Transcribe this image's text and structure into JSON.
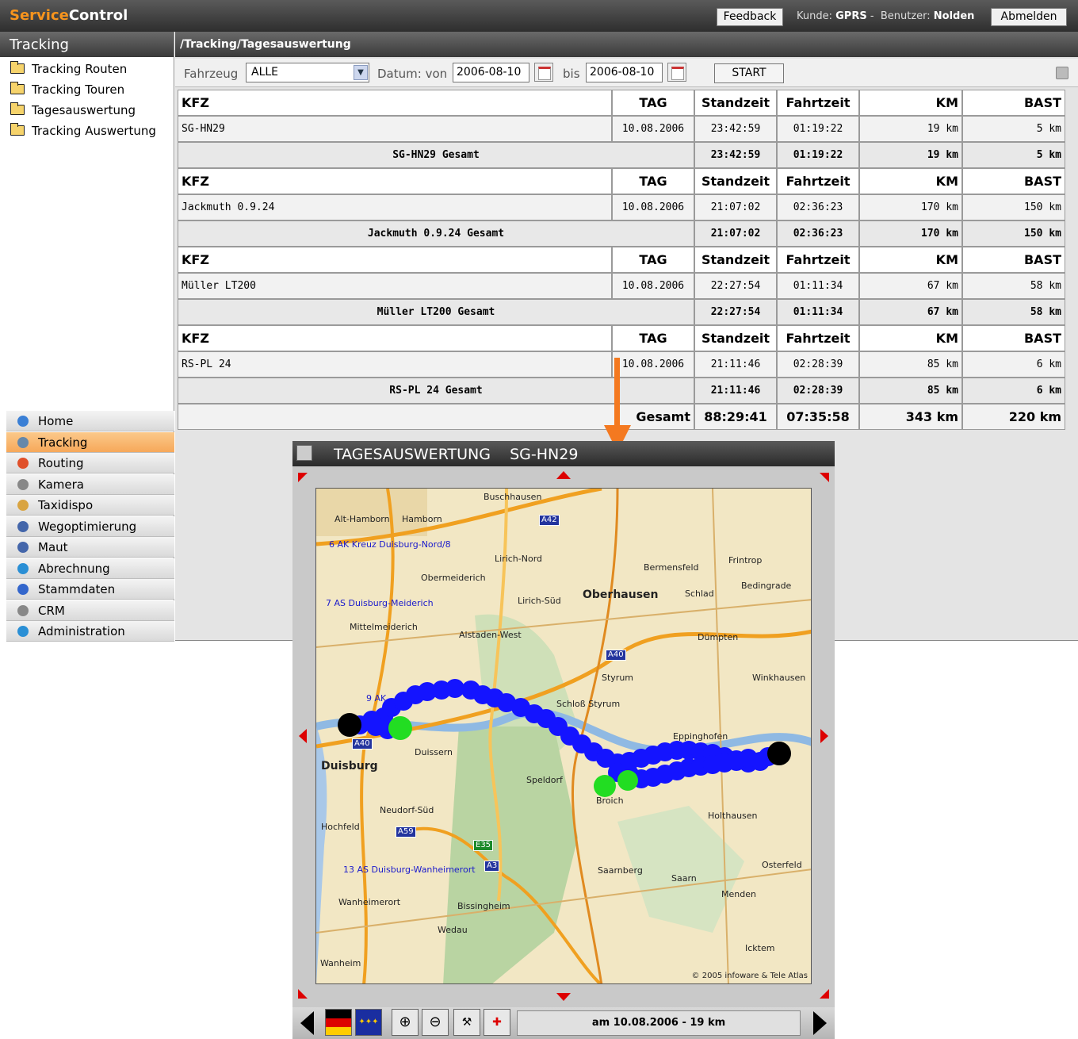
{
  "header": {
    "logo_part1": "Service",
    "logo_part2": "Control",
    "feedback": "Feedback",
    "kunde_label": "Kunde:",
    "kunde": "GPRS",
    "separator": "-",
    "benutzer_label": "Benutzer:",
    "benutzer": "Nolden",
    "abmelden": "Abmelden"
  },
  "sidebar": {
    "title": "Tracking",
    "tree": [
      "Tracking Routen",
      "Tracking Touren",
      "Tagesauswertung",
      "Tracking Auswertung"
    ],
    "nav": [
      {
        "label": "Home",
        "icon": "home-icon",
        "color": "#3a7fd5"
      },
      {
        "label": "Tracking",
        "icon": "tracking-icon",
        "color": "#6688aa",
        "active": true
      },
      {
        "label": "Routing",
        "icon": "routing-icon",
        "color": "#e0502a"
      },
      {
        "label": "Kamera",
        "icon": "camera-icon",
        "color": "#888888"
      },
      {
        "label": "Taxidispo",
        "icon": "taxi-icon",
        "color": "#d9a441"
      },
      {
        "label": "Wegoptimierung",
        "icon": "route-opt-icon",
        "color": "#4466aa"
      },
      {
        "label": "Maut",
        "icon": "toll-icon",
        "color": "#4466aa"
      },
      {
        "label": "Abrechnung",
        "icon": "billing-icon",
        "color": "#2a8fd5"
      },
      {
        "label": "Stammdaten",
        "icon": "master-data-icon",
        "color": "#3366cc"
      },
      {
        "label": "CRM",
        "icon": "crm-icon",
        "color": "#888888"
      },
      {
        "label": "Administration",
        "icon": "admin-icon",
        "color": "#2a8fd5"
      }
    ]
  },
  "main": {
    "breadcrumb": "/Tracking/Tagesauswertung",
    "filter": {
      "fahrzeug_label": "Fahrzeug",
      "fahrzeug_value": "ALLE",
      "datum_label": "Datum: von",
      "from": "2006-08-10",
      "bis_label": "bis",
      "to": "2006-08-10",
      "start": "START"
    },
    "columns": [
      "KFZ",
      "TAG",
      "Standzeit",
      "Fahrtzeit",
      "KM",
      "BAST"
    ],
    "groups": [
      {
        "kfz": "SG-HN29",
        "tag": "10.08.2006",
        "stand": "23:42:59",
        "fahrt": "01:19:22",
        "km": "19 km",
        "bast": "5 km",
        "total_label": "SG-HN29  Gesamt",
        "t_stand": "23:42:59",
        "t_fahrt": "01:19:22",
        "t_km": "19 km",
        "t_bast": "5 km"
      },
      {
        "kfz": "Jackmuth 0.9.24",
        "tag": "10.08.2006",
        "stand": "21:07:02",
        "fahrt": "02:36:23",
        "km": "170 km",
        "bast": "150 km",
        "total_label": "Jackmuth 0.9.24  Gesamt",
        "t_stand": "21:07:02",
        "t_fahrt": "02:36:23",
        "t_km": "170 km",
        "t_bast": "150 km"
      },
      {
        "kfz": "Müller LT200",
        "tag": "10.08.2006",
        "stand": "22:27:54",
        "fahrt": "01:11:34",
        "km": "67 km",
        "bast": "58 km",
        "total_label": "Müller LT200  Gesamt",
        "t_stand": "22:27:54",
        "t_fahrt": "01:11:34",
        "t_km": "67 km",
        "t_bast": "58 km"
      },
      {
        "kfz": "RS-PL 24",
        "tag": "10.08.2006",
        "stand": "21:11:46",
        "fahrt": "02:28:39",
        "km": "85 km",
        "bast": "6 km",
        "total_label": "RS-PL 24  Gesamt",
        "t_stand": "21:11:46",
        "t_fahrt": "02:28:39",
        "t_km": "85 km",
        "t_bast": "6 km"
      }
    ],
    "grand": {
      "label": "Gesamt",
      "stand": "88:29:41",
      "fahrt": "07:35:58",
      "km": "343 km",
      "bast": "220 km"
    }
  },
  "mapwin": {
    "title": "TAGESAUSWERTUNG    SG-HN29",
    "status": "am 10.08.2006 - 19 km",
    "copyright": "© 2005 infoware & Tele Atlas",
    "places": [
      "Buschhausen",
      "Alt-Hamborn",
      "Hamborn",
      "6 AK Kreuz Duisburg-Nord/8",
      "Lirich-Nord",
      "Obermeiderich",
      "Bermensfeld",
      "Frintrop",
      "Bedingrade",
      "Schlad",
      "Oberhausen",
      "Lirich-Süd",
      "7 AS Duisburg-Meiderich",
      "Mittelmeiderich",
      "Alstaden-West",
      "Dümpten",
      "Styrum",
      "Winkhausen",
      "Schloß Styrum",
      "9 AK",
      "Eppinghofen",
      "Duissern",
      "Duisburg",
      "Speldorf",
      "Broich",
      "Holthausen",
      "Neudorf-Süd",
      "Hochfeld",
      "13 AS Duisburg-Wanheimerort",
      "Saarnberg",
      "Saarn",
      "Osterfeld",
      "Menden",
      "Wanheimerort",
      "Bissingheim",
      "Wedau",
      "Icktem",
      "Wanheim"
    ],
    "shields": [
      "A42",
      "A40",
      "A40",
      "A59",
      "E35",
      "A3"
    ]
  }
}
